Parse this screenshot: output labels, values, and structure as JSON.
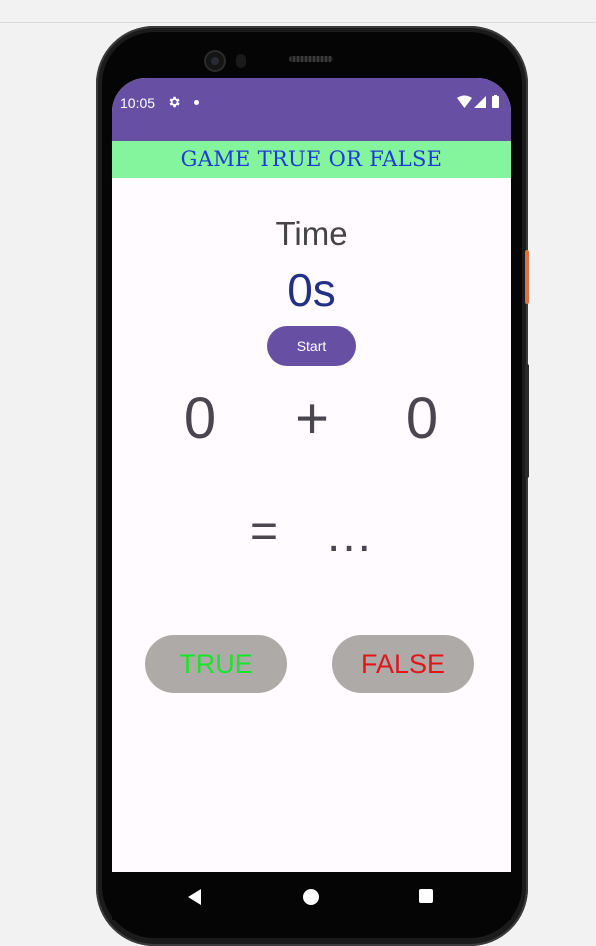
{
  "status_bar": {
    "time": "10:05",
    "icons": [
      "gear-icon",
      "notification-dot-icon",
      "wifi-icon",
      "signal-icon",
      "battery-icon"
    ],
    "color": "#6750a4"
  },
  "app": {
    "title": "GAME TRUE OR FALSE",
    "title_bar_color": "#84f59d",
    "title_text_color": "#1e3ad8"
  },
  "timer": {
    "label": "Time",
    "value": "0s",
    "start_label": "Start"
  },
  "equation": {
    "operand_a": "0",
    "operator": "+",
    "operand_b": "0",
    "equals": "=",
    "result": "..."
  },
  "answers": {
    "true_label": "TRUE",
    "false_label": "FALSE",
    "true_color": "#16e62a",
    "false_color": "#e0161b",
    "button_color": "#aeaaa8"
  },
  "nav_bar": {
    "icons": [
      "back-icon",
      "home-icon",
      "recents-icon"
    ]
  }
}
